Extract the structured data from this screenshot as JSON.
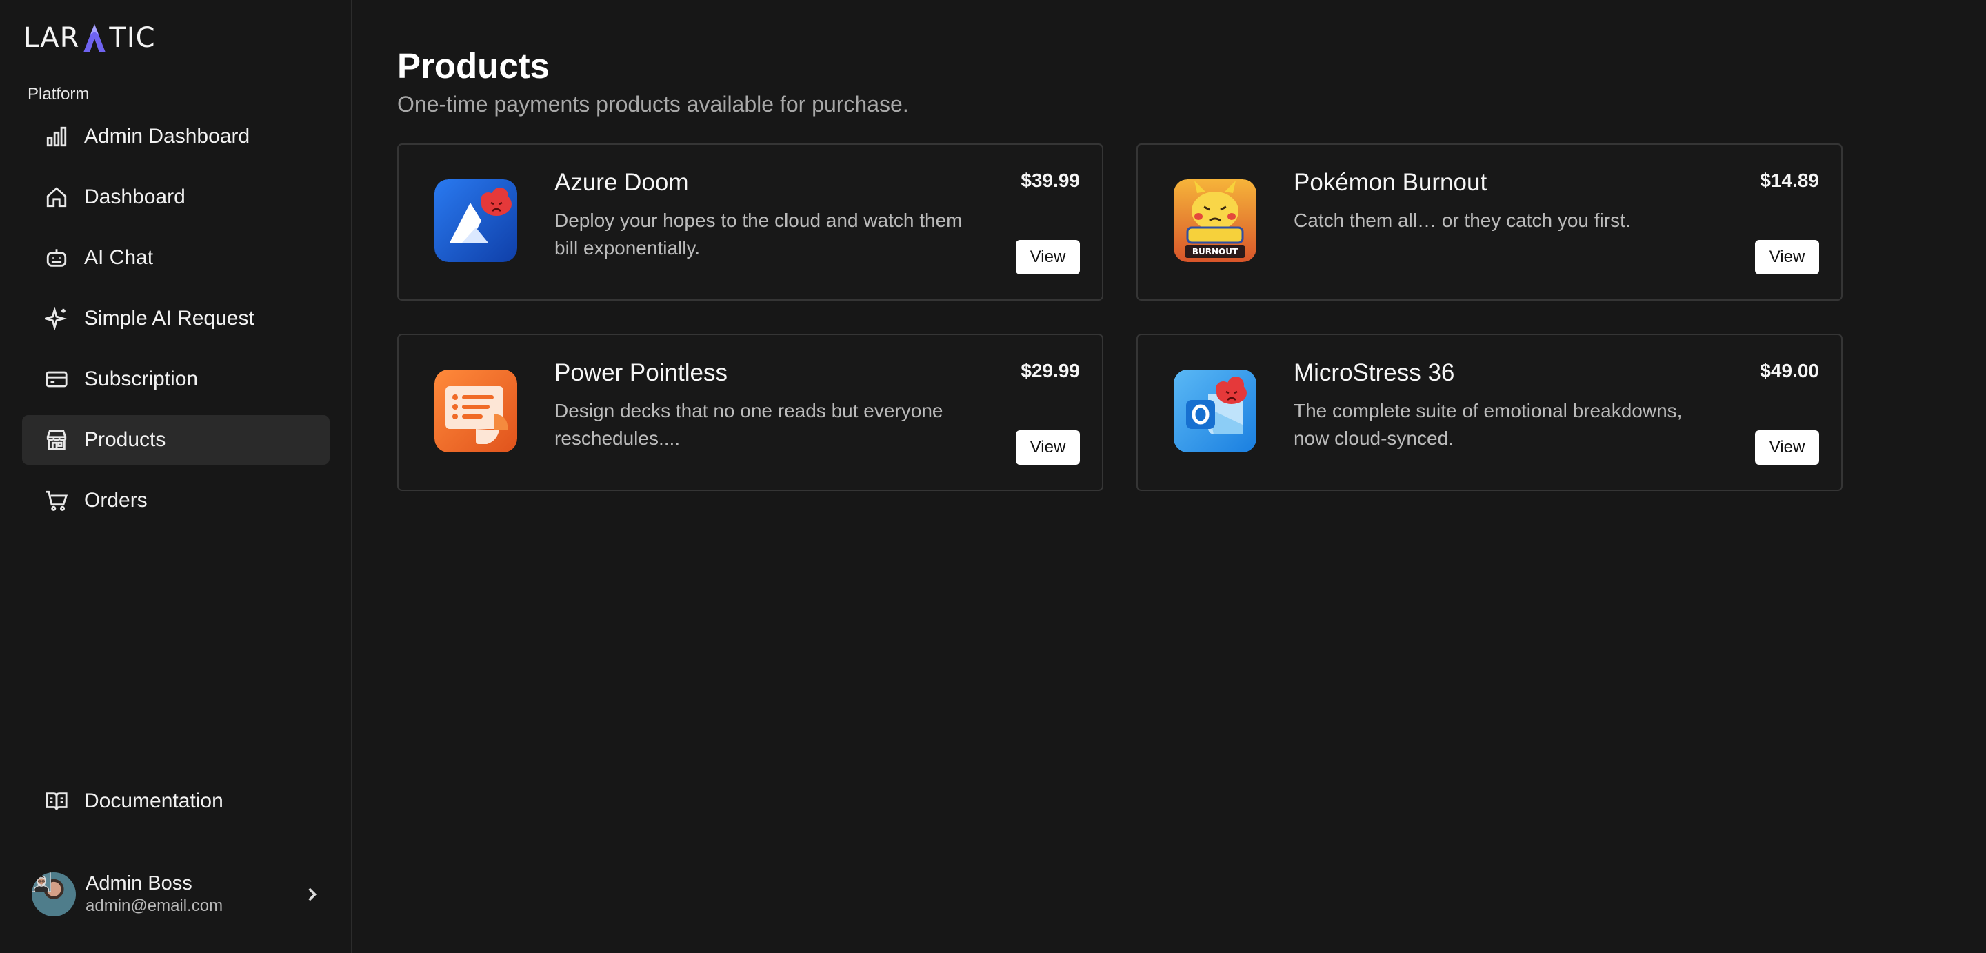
{
  "brand": {
    "logo_text_left": "LAR",
    "logo_text_right": "TIC",
    "logo_accent": "#7c6cf5"
  },
  "sidebar": {
    "section_label": "Platform",
    "items": [
      {
        "label": "Admin Dashboard",
        "icon": "bar-chart-icon",
        "active": false
      },
      {
        "label": "Dashboard",
        "icon": "home-icon",
        "active": false
      },
      {
        "label": "AI Chat",
        "icon": "bot-icon",
        "active": false
      },
      {
        "label": "Simple AI Request",
        "icon": "sparkles-icon",
        "active": false
      },
      {
        "label": "Subscription",
        "icon": "credit-card-icon",
        "active": false
      },
      {
        "label": "Products",
        "icon": "store-icon",
        "active": true
      },
      {
        "label": "Orders",
        "icon": "shopping-cart-icon",
        "active": false
      }
    ],
    "documentation": {
      "label": "Documentation",
      "icon": "book-open-icon"
    },
    "user": {
      "name": "Admin Boss",
      "email": "admin@email.com"
    }
  },
  "main": {
    "title": "Products",
    "subtitle": "One-time payments products available for purchase.",
    "products": [
      {
        "name": "Azure Doom",
        "description": "Deploy your hopes to the cloud and watch them bill exponentially.",
        "price": "$39.99",
        "button": "View",
        "icon": "azure-doom-icon",
        "color": "#1e63d6"
      },
      {
        "name": "Pokémon Burnout",
        "description": "Catch them all… or they catch you first.",
        "price": "$14.89",
        "button": "View",
        "icon": "pokemon-burnout-icon",
        "color": "#f0a020"
      },
      {
        "name": "Power Pointless",
        "description": "Design decks that no one reads but everyone reschedules....",
        "price": "$29.99",
        "button": "View",
        "icon": "power-pointless-icon",
        "color": "#f26d21"
      },
      {
        "name": "MicroStress 36",
        "description": "The complete suite of emotional breakdowns, now cloud-synced.",
        "price": "$49.00",
        "button": "View",
        "icon": "microstress-icon",
        "color": "#1e8ee8"
      }
    ],
    "badge_text": "BURNOUT"
  }
}
